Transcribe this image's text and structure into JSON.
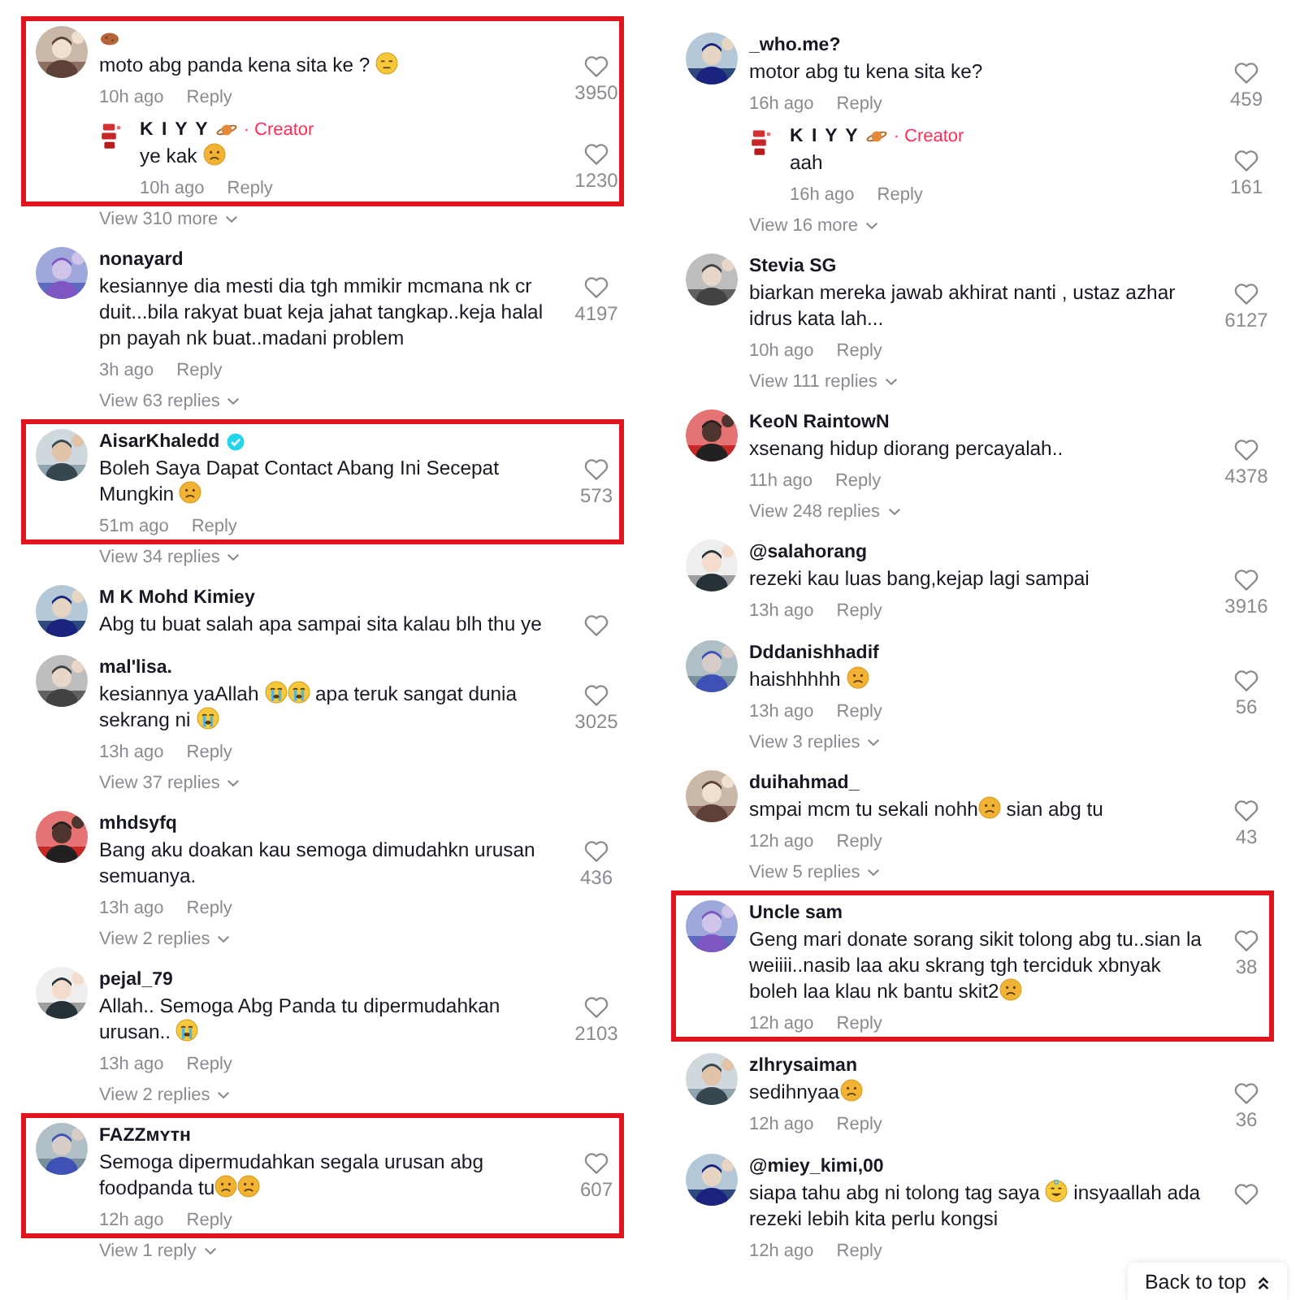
{
  "columns": [
    {
      "comments": [
        {
          "author_parts": [
            {
              "kind": "potato"
            }
          ],
          "parts": [
            {
              "kind": "text",
              "text": "moto abg panda kena sita ke ? "
            },
            {
              "kind": "emoji_flat"
            }
          ],
          "time": "10h ago",
          "reply_label": "Reply",
          "likes": "3950",
          "highlighted": true,
          "replies": [
            {
              "author_parts": [
                {
                  "kind": "text",
                  "text": "K I Y Y"
                },
                {
                  "kind": "planet"
                }
              ],
              "tag": "· Creator",
              "parts": [
                {
                  "kind": "text",
                  "text": "ye kak "
                },
                {
                  "kind": "emoji_sad"
                }
              ],
              "time": "10h ago",
              "reply_label": "Reply",
              "likes": "1230"
            }
          ],
          "more": "View 310 more"
        },
        {
          "author_parts": [
            {
              "kind": "text",
              "text": "nonayard"
            }
          ],
          "parts": [
            {
              "kind": "text",
              "text": "kesiannye dia mesti dia tgh mmikir mcmana nk cr duit...bila rakyat buat keja jahat tangkap..keja halal pn payah nk buat..madani problem"
            }
          ],
          "time": "3h ago",
          "reply_label": "Reply",
          "likes": "4197",
          "highlighted": false,
          "more": "View 63 replies"
        },
        {
          "author_parts": [
            {
              "kind": "text",
              "text": "AisarKhaledd"
            },
            {
              "kind": "verified"
            }
          ],
          "parts": [
            {
              "kind": "text",
              "text": "Boleh Saya Dapat Contact Abang Ini Secepat Mungkin "
            },
            {
              "kind": "emoji_sad"
            }
          ],
          "time": "51m ago",
          "reply_label": "Reply",
          "likes": "573",
          "highlighted": true,
          "more": "View 34 replies"
        },
        {
          "author_parts": [
            {
              "kind": "text",
              "text": "M K Mohd Kimiey"
            }
          ],
          "parts": [
            {
              "kind": "text",
              "text": "Abg tu buat salah apa sampai sita kalau blh thu ye"
            }
          ],
          "highlighted": false
        },
        {
          "author_parts": [
            {
              "kind": "text",
              "text": "mal'lisa."
            }
          ],
          "parts": [
            {
              "kind": "text",
              "text": "kesiannya yaAllah "
            },
            {
              "kind": "emoji_cry"
            },
            {
              "kind": "emoji_cry"
            },
            {
              "kind": "text",
              "text": " apa teruk sangat dunia sekrang ni "
            },
            {
              "kind": "emoji_cry"
            }
          ],
          "time": "13h ago",
          "reply_label": "Reply",
          "likes": "3025",
          "highlighted": false,
          "more": "View 37 replies"
        },
        {
          "author_parts": [
            {
              "kind": "text",
              "text": "mhdsyfq"
            }
          ],
          "parts": [
            {
              "kind": "text",
              "text": "Bang aku doakan kau semoga dimudahkn urusan semuanya."
            }
          ],
          "time": "13h ago",
          "reply_label": "Reply",
          "likes": "436",
          "highlighted": false,
          "more": "View 2 replies"
        },
        {
          "author_parts": [
            {
              "kind": "text",
              "text": "pejal_79"
            }
          ],
          "parts": [
            {
              "kind": "text",
              "text": "Allah.. Semoga Abg Panda tu dipermudahkan urusan.. "
            },
            {
              "kind": "emoji_cry"
            }
          ],
          "time": "13h ago",
          "reply_label": "Reply",
          "likes": "2103",
          "highlighted": false,
          "more": "View 2 replies"
        },
        {
          "author_parts": [
            {
              "kind": "text",
              "text": "FAZZᴍʏᴛʜ"
            }
          ],
          "parts": [
            {
              "kind": "text",
              "text": "Semoga dipermudahkan segala urusan abg foodpanda tu"
            },
            {
              "kind": "emoji_sad"
            },
            {
              "kind": "emoji_sad"
            }
          ],
          "time": "12h ago",
          "reply_label": "Reply",
          "likes": "607",
          "highlighted": true,
          "more": "View 1 reply"
        }
      ]
    },
    {
      "comments": [
        {
          "author_parts": [
            {
              "kind": "text",
              "text": "_who.me?"
            }
          ],
          "parts": [
            {
              "kind": "text",
              "text": "motor abg tu kena sita ke?"
            }
          ],
          "time": "16h ago",
          "reply_label": "Reply",
          "likes": "459",
          "highlighted": false,
          "replies": [
            {
              "author_parts": [
                {
                  "kind": "text",
                  "text": "K I Y Y"
                },
                {
                  "kind": "planet"
                }
              ],
              "tag": "· Creator",
              "parts": [
                {
                  "kind": "text",
                  "text": "aah"
                }
              ],
              "time": "16h ago",
              "reply_label": "Reply",
              "likes": "161"
            }
          ],
          "more": "View 16 more"
        },
        {
          "author_parts": [
            {
              "kind": "text",
              "text": "Stevia SG"
            }
          ],
          "parts": [
            {
              "kind": "text",
              "text": "biarkan mereka jawab akhirat nanti , ustaz azhar idrus kata lah..."
            }
          ],
          "time": "10h ago",
          "reply_label": "Reply",
          "likes": "6127",
          "highlighted": false,
          "more": "View 111 replies"
        },
        {
          "author_parts": [
            {
              "kind": "text",
              "text": "KeoN RaintowN"
            }
          ],
          "parts": [
            {
              "kind": "text",
              "text": "xsenang hidup diorang percayalah.."
            }
          ],
          "time": "11h ago",
          "reply_label": "Reply",
          "likes": "4378",
          "highlighted": false,
          "more": "View 248 replies"
        },
        {
          "author_parts": [
            {
              "kind": "text",
              "text": "@salahorang"
            }
          ],
          "parts": [
            {
              "kind": "text",
              "text": "rezeki kau luas bang,kejap lagi sampai"
            }
          ],
          "time": "13h ago",
          "reply_label": "Reply",
          "likes": "3916",
          "highlighted": false
        },
        {
          "author_parts": [
            {
              "kind": "text",
              "text": "Dddanishhadif"
            }
          ],
          "parts": [
            {
              "kind": "text",
              "text": "haishhhhh "
            },
            {
              "kind": "emoji_sad"
            }
          ],
          "time": "13h ago",
          "reply_label": "Reply",
          "likes": "56",
          "highlighted": false,
          "more": "View 3 replies"
        },
        {
          "author_parts": [
            {
              "kind": "text",
              "text": "duihahmad_"
            }
          ],
          "parts": [
            {
              "kind": "text",
              "text": "smpai mcm tu sekali nohh"
            },
            {
              "kind": "emoji_sad"
            },
            {
              "kind": "text",
              "text": " sian abg tu"
            }
          ],
          "time": "12h ago",
          "reply_label": "Reply",
          "likes": "43",
          "highlighted": false,
          "more": "View 5 replies"
        },
        {
          "author_parts": [
            {
              "kind": "text",
              "text": "Uncle sam"
            }
          ],
          "parts": [
            {
              "kind": "text",
              "text": "Geng mari donate sorang sikit tolong abg tu..sian la weiiii..nasib laa aku skrang tgh terciduk xbnyak boleh laa klau nk bantu skit2"
            },
            {
              "kind": "emoji_sad"
            }
          ],
          "time": "12h ago",
          "reply_label": "Reply",
          "likes": "38",
          "highlighted": true
        },
        {
          "author_parts": [
            {
              "kind": "text",
              "text": "zlhrysaiman"
            }
          ],
          "parts": [
            {
              "kind": "text",
              "text": "sedihnyaa"
            },
            {
              "kind": "emoji_sad"
            }
          ],
          "time": "12h ago",
          "reply_label": "Reply",
          "likes": "36",
          "highlighted": false
        },
        {
          "author_parts": [
            {
              "kind": "text",
              "text": "@miey_kimi,00"
            }
          ],
          "parts": [
            {
              "kind": "text",
              "text": "siapa tahu abg ni tolong tag saya "
            },
            {
              "kind": "emoji_smile"
            },
            {
              "kind": "text",
              "text": " insyaallah ada rezeki lebih kita perlu kongsi"
            }
          ],
          "time": "12h ago",
          "reply_label": "Reply",
          "highlighted": false
        }
      ]
    }
  ],
  "back_to_top": {
    "label": "Back to top"
  }
}
